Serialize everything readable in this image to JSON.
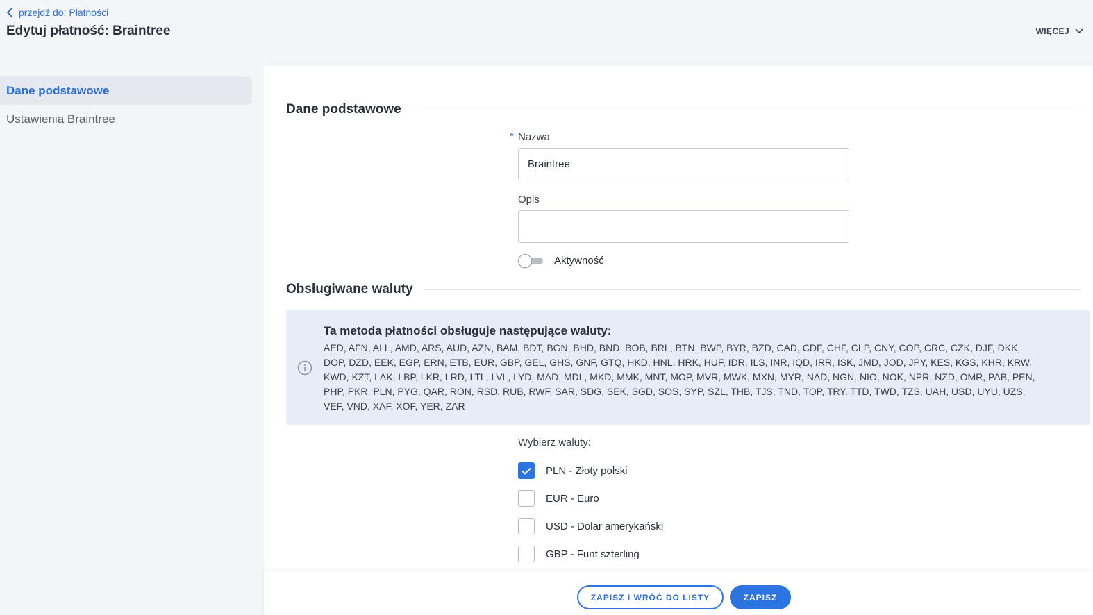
{
  "header": {
    "back_label": "przejdź do: Płatności",
    "title": "Edytuj płatność: Braintree",
    "more_label": "WIĘCEJ"
  },
  "sidebar": {
    "items": [
      {
        "label": "Dane podstawowe",
        "active": true
      },
      {
        "label": "Ustawienia Braintree",
        "active": false
      }
    ]
  },
  "section_basic": {
    "title": "Dane podstawowe",
    "name_label": "Nazwa",
    "required_mark": "*",
    "name_value": "Braintree",
    "description_label": "Opis",
    "description_value": "",
    "active_label": "Aktywność",
    "active": false
  },
  "section_currencies": {
    "title": "Obsługiwane waluty",
    "info_title": "Ta metoda płatności obsługuje następujące waluty:",
    "info_text": "AED, AFN, ALL, AMD, ARS, AUD, AZN, BAM, BDT, BGN, BHD, BND, BOB, BRL, BTN, BWP, BYR, BZD, CAD, CDF, CHF, CLP, CNY, COP, CRC, CZK, DJF, DKK, DOP, DZD, EEK, EGP, ERN, ETB, EUR, GBP, GEL, GHS, GNF, GTQ, HKD, HNL, HRK, HUF, IDR, ILS, INR, IQD, IRR, ISK, JMD, JOD, JPY, KES, KGS, KHR, KRW, KWD, KZT, LAK, LBP, LKR, LRD, LTL, LVL, LYD, MAD, MDL, MKD, MMK, MNT, MOP, MVR, MWK, MXN, MYR, NAD, NGN, NIO, NOK, NPR, NZD, OMR, PAB, PEN, PHP, PKR, PLN, PYG, QAR, RON, RSD, RUB, RWF, SAR, SDG, SEK, SGD, SOS, SYP, SZL, THB, TJS, TND, TOP, TRY, TTD, TWD, TZS, UAH, USD, UYU, UZS, VEF, VND, XAF, XOF, YER, ZAR",
    "pick_label": "Wybierz waluty:",
    "options": [
      {
        "label": "PLN - Złoty polski",
        "checked": true
      },
      {
        "label": "EUR - Euro",
        "checked": false
      },
      {
        "label": "USD - Dolar amerykański",
        "checked": false
      },
      {
        "label": "GBP - Funt szterling",
        "checked": false
      }
    ]
  },
  "footer": {
    "save_back_label": "ZAPISZ I WRÓĆ DO LISTY",
    "save_label": "ZAPISZ"
  },
  "colors": {
    "accent": "#2c74e0",
    "link": "#2c6fd3",
    "info_bg": "#e8ecf6",
    "page_bg": "#f4f5f8"
  }
}
